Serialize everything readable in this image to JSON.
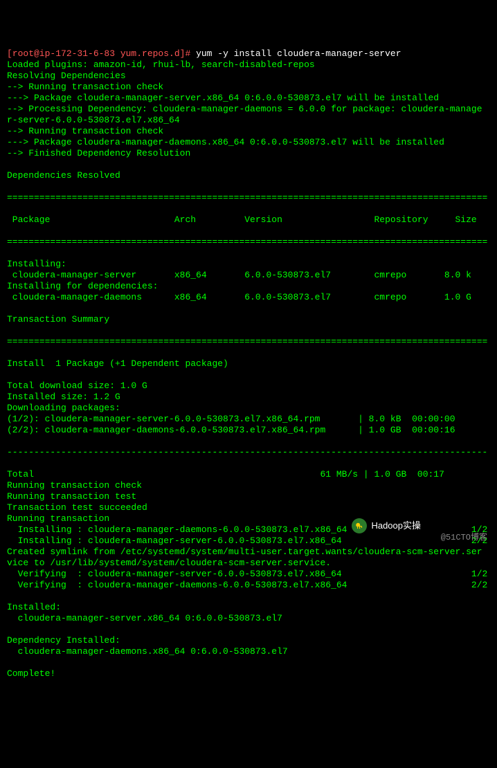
{
  "prompt": {
    "user_host": "[root@ip-172-31-6-83 yum.repos.d]#",
    "command": "yum -y install cloudera-manager-server"
  },
  "preamble": [
    "Loaded plugins: amazon-id, rhui-lb, search-disabled-repos",
    "Resolving Dependencies",
    "--> Running transaction check",
    "---> Package cloudera-manager-server.x86_64 0:6.0.0-530873.el7 will be installed",
    "--> Processing Dependency: cloudera-manager-daemons = 6.0.0 for package: cloudera-manage",
    "r-server-6.0.0-530873.el7.x86_64",
    "--> Running transaction check",
    "---> Package cloudera-manager-daemons.x86_64 0:6.0.0-530873.el7 will be installed",
    "--> Finished Dependency Resolution",
    "",
    "Dependencies Resolved",
    ""
  ],
  "table": {
    "sep": "=========================================================================================",
    "header": " Package                       Arch         Version                 Repository     Size",
    "rows": [
      "Installing:",
      " cloudera-manager-server       x86_64       6.0.0-530873.el7        cmrepo       8.0 k",
      "Installing for dependencies:",
      " cloudera-manager-daemons      x86_64       6.0.0-530873.el7        cmrepo       1.0 G",
      "",
      "Transaction Summary"
    ]
  },
  "summary": [
    "Install  1 Package (+1 Dependent package)",
    "",
    "Total download size: 1.0 G",
    "Installed size: 1.2 G",
    "Downloading packages:",
    "(1/2): cloudera-manager-server-6.0.0-530873.el7.x86_64.rpm       | 8.0 kB  00:00:00",
    "(2/2): cloudera-manager-daemons-6.0.0-530873.el7.x86_64.rpm      | 1.0 GB  00:00:16"
  ],
  "dash": "-----------------------------------------------------------------------------------------",
  "post": [
    "Total                                                     61 MB/s | 1.0 GB  00:17",
    "Running transaction check",
    "Running transaction test",
    "Transaction test succeeded",
    "Running transaction",
    "  Installing : cloudera-manager-daemons-6.0.0-530873.el7.x86_64                       1/2",
    "  Installing : cloudera-manager-server-6.0.0-530873.el7.x86_64                        2/2",
    "Created symlink from /etc/systemd/system/multi-user.target.wants/cloudera-scm-server.ser",
    "vice to /usr/lib/systemd/system/cloudera-scm-server.service.",
    "  Verifying  : cloudera-manager-server-6.0.0-530873.el7.x86_64                        1/2",
    "  Verifying  : cloudera-manager-daemons-6.0.0-530873.el7.x86_64                       2/2",
    "",
    "Installed:",
    "  cloudera-manager-server.x86_64 0:6.0.0-530873.el7",
    "",
    "Dependency Installed:",
    "  cloudera-manager-daemons.x86_64 0:6.0.0-530873.el7",
    "",
    "Complete!"
  ],
  "badge": {
    "label": "Hadoop实操"
  },
  "watermark": {
    "text": "@51CTO博客"
  }
}
